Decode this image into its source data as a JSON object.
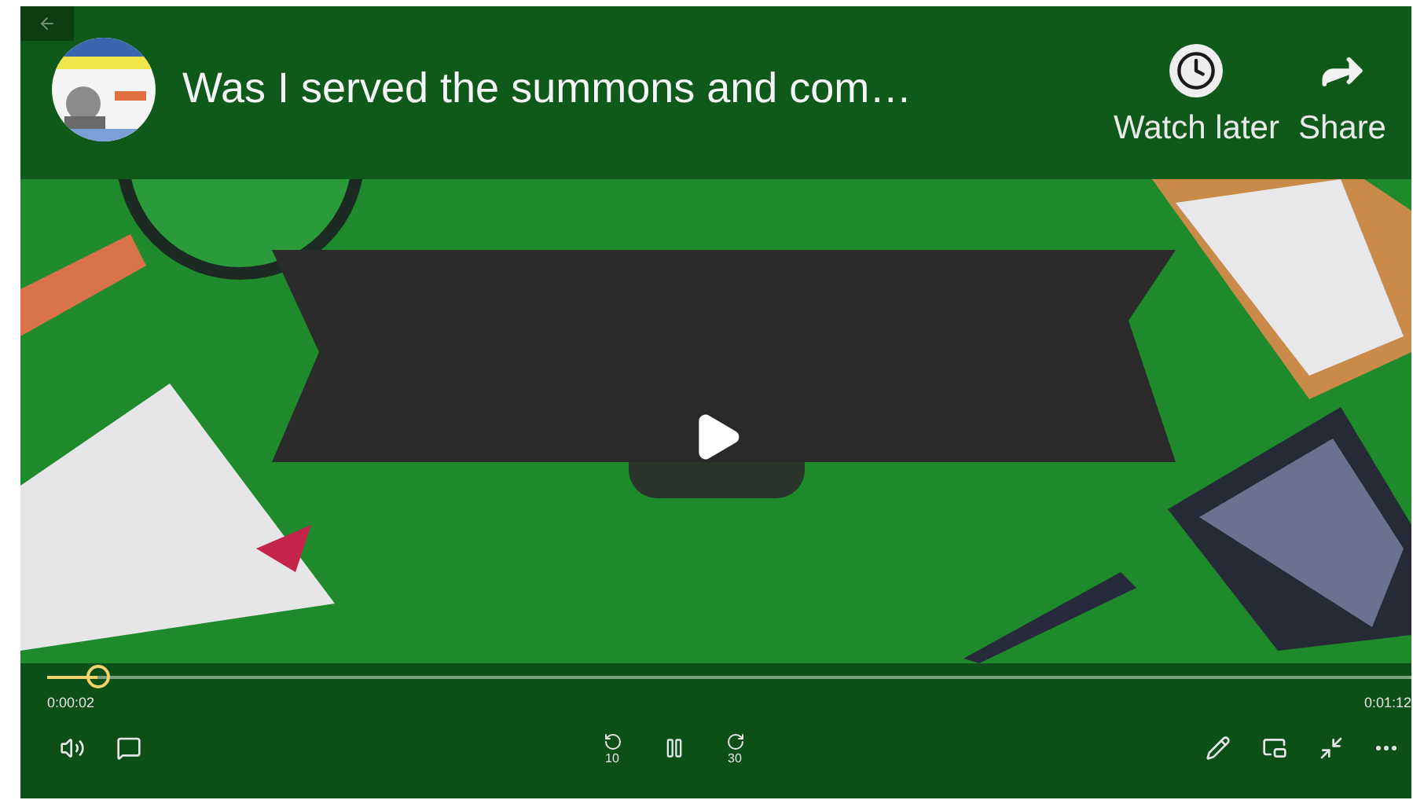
{
  "player": {
    "video_title": "Was I served the summons and com…",
    "actions": [
      {
        "kind": "clock",
        "label": "Watch later"
      },
      {
        "kind": "share",
        "label": "Share"
      }
    ],
    "playing": true,
    "seek": {
      "level": 0.037,
      "elapsed": "0:00:02",
      "duration": "0:01:12"
    },
    "skip_back": "10",
    "skip_forward": "30"
  }
}
